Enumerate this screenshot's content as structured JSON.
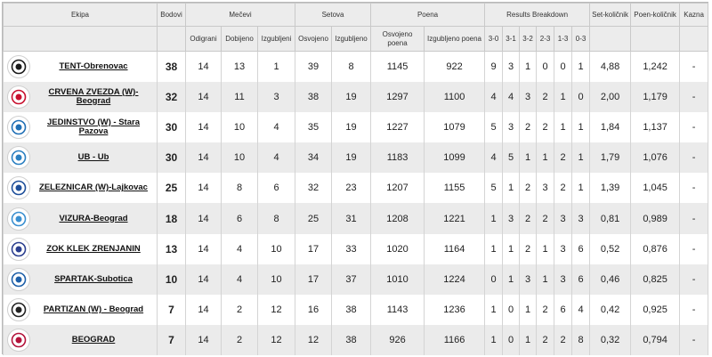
{
  "headers": {
    "ekipa": "Ekipa",
    "bodovi": "Bodovi",
    "mecevi": "Mečevi",
    "setova": "Setova",
    "poena": "Poena",
    "breakdown": "Results Breakdown",
    "setkolicnik": "Set-količnik",
    "poenkolicnik": "Poen-količnik",
    "kazna": "Kazna",
    "odigrani": "Odigrani",
    "dobijeno": "Dobijeno",
    "izgubljeni": "Izgubljeni",
    "osvojeno": "Osvojeno",
    "izgubljeno": "Izgubljeno",
    "osvojeno_poena": "Osvojeno poena",
    "izgubljeno_poena": "Izgubljeno poena",
    "r30": "3-0",
    "r31": "3-1",
    "r32": "3-2",
    "r23": "2-3",
    "r13": "1-3",
    "r03": "0-3"
  },
  "rows": [
    {
      "team": "TENT-Obrenovac",
      "bodovi": "38",
      "odigrani": "14",
      "dobijeno": "13",
      "izgubljeni": "1",
      "osvojeno": "39",
      "izgubljeno": "8",
      "osvojeno_poena": "1145",
      "izgubljeno_poena": "922",
      "r30": "9",
      "r31": "3",
      "r32": "1",
      "r23": "0",
      "r13": "0",
      "r03": "1",
      "setk": "4,88",
      "poenk": "1,242",
      "kazna": "-",
      "logo": "tent-logo-icon",
      "color": "#1a1a1a"
    },
    {
      "team": "CRVENA ZVEZDA (W)-Beograd",
      "bodovi": "32",
      "odigrani": "14",
      "dobijeno": "11",
      "izgubljeni": "3",
      "osvojeno": "38",
      "izgubljeno": "19",
      "osvojeno_poena": "1297",
      "izgubljeno_poena": "1100",
      "r30": "4",
      "r31": "4",
      "r32": "3",
      "r23": "2",
      "r13": "1",
      "r03": "0",
      "setk": "2,00",
      "poenk": "1,179",
      "kazna": "-",
      "logo": "crvena-zvezda-logo-icon",
      "color": "#c8102e"
    },
    {
      "team": "JEDINSTVO (W) - Stara Pazova",
      "bodovi": "30",
      "odigrani": "14",
      "dobijeno": "10",
      "izgubljeni": "4",
      "osvojeno": "35",
      "izgubljeno": "19",
      "osvojeno_poena": "1227",
      "izgubljeno_poena": "1079",
      "r30": "5",
      "r31": "3",
      "r32": "2",
      "r23": "2",
      "r13": "1",
      "r03": "1",
      "setk": "1,84",
      "poenk": "1,137",
      "kazna": "-",
      "logo": "jedinstvo-logo-icon",
      "color": "#1f6fb5"
    },
    {
      "team": "UB - Ub",
      "bodovi": "30",
      "odigrani": "14",
      "dobijeno": "10",
      "izgubljeni": "4",
      "osvojeno": "34",
      "izgubljeno": "19",
      "osvojeno_poena": "1183",
      "izgubljeno_poena": "1099",
      "r30": "4",
      "r31": "5",
      "r32": "1",
      "r23": "1",
      "r13": "2",
      "r03": "1",
      "setk": "1,79",
      "poenk": "1,076",
      "kazna": "-",
      "logo": "ub-logo-icon",
      "color": "#2a7fc1"
    },
    {
      "team": "ZELEZNICAR (W)-Lajkovac",
      "bodovi": "25",
      "odigrani": "14",
      "dobijeno": "8",
      "izgubljeni": "6",
      "osvojeno": "32",
      "izgubljeno": "23",
      "osvojeno_poena": "1207",
      "izgubljeno_poena": "1155",
      "r30": "5",
      "r31": "1",
      "r32": "2",
      "r23": "3",
      "r13": "2",
      "r03": "1",
      "setk": "1,39",
      "poenk": "1,045",
      "kazna": "-",
      "logo": "zeleznicar-logo-icon",
      "color": "#1e4f9a"
    },
    {
      "team": "VIZURA-Beograd",
      "bodovi": "18",
      "odigrani": "14",
      "dobijeno": "6",
      "izgubljeni": "8",
      "osvojeno": "25",
      "izgubljeno": "31",
      "osvojeno_poena": "1208",
      "izgubljeno_poena": "1221",
      "r30": "1",
      "r31": "3",
      "r32": "2",
      "r23": "2",
      "r13": "3",
      "r03": "3",
      "setk": "0,81",
      "poenk": "0,989",
      "kazna": "-",
      "logo": "vizura-logo-icon",
      "color": "#3a8fd0"
    },
    {
      "team": "ZOK KLEK ZRENJANIN",
      "bodovi": "13",
      "odigrani": "14",
      "dobijeno": "4",
      "izgubljeni": "10",
      "osvojeno": "17",
      "izgubljeno": "33",
      "osvojeno_poena": "1020",
      "izgubljeno_poena": "1164",
      "r30": "1",
      "r31": "1",
      "r32": "2",
      "r23": "1",
      "r13": "3",
      "r03": "6",
      "setk": "0,52",
      "poenk": "0,876",
      "kazna": "-",
      "logo": "klek-logo-icon",
      "color": "#2b3f8f"
    },
    {
      "team": "SPARTAK-Subotica",
      "bodovi": "10",
      "odigrani": "14",
      "dobijeno": "4",
      "izgubljeni": "10",
      "osvojeno": "17",
      "izgubljeno": "37",
      "osvojeno_poena": "1010",
      "izgubljeno_poena": "1224",
      "r30": "0",
      "r31": "1",
      "r32": "3",
      "r23": "1",
      "r13": "3",
      "r03": "6",
      "setk": "0,46",
      "poenk": "0,825",
      "kazna": "-",
      "logo": "spartak-logo-icon",
      "color": "#1d5fa8"
    },
    {
      "team": "PARTIZAN (W) - Beograd",
      "bodovi": "7",
      "odigrani": "14",
      "dobijeno": "2",
      "izgubljeni": "12",
      "osvojeno": "16",
      "izgubljeno": "38",
      "osvojeno_poena": "1143",
      "izgubljeno_poena": "1236",
      "r30": "1",
      "r31": "0",
      "r32": "1",
      "r23": "2",
      "r13": "6",
      "r03": "4",
      "setk": "0,42",
      "poenk": "0,925",
      "kazna": "-",
      "logo": "partizan-logo-icon",
      "color": "#222222"
    },
    {
      "team": "BEOGRAD",
      "bodovi": "7",
      "odigrani": "14",
      "dobijeno": "2",
      "izgubljeni": "12",
      "osvojeno": "12",
      "izgubljeno": "38",
      "osvojeno_poena": "926",
      "izgubljeno_poena": "1166",
      "r30": "1",
      "r31": "0",
      "r32": "1",
      "r23": "2",
      "r13": "2",
      "r03": "8",
      "setk": "0,32",
      "poenk": "0,794",
      "kazna": "-",
      "logo": "beograd-logo-icon",
      "color": "#b3123a"
    }
  ]
}
